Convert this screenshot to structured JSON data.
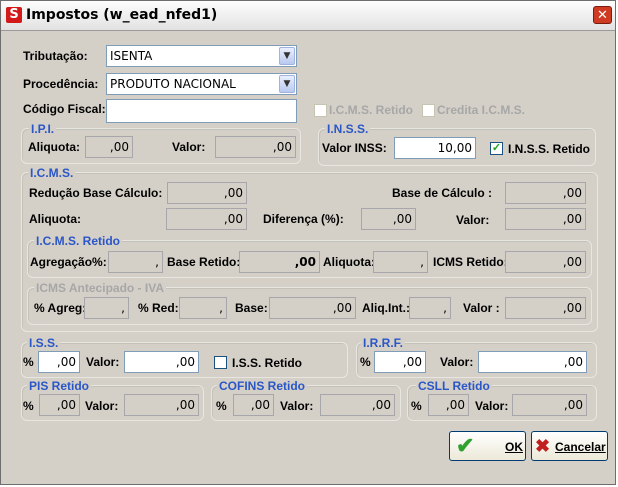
{
  "window": {
    "title": "Impostos (w_ead_nfed1)",
    "app_icon": "S",
    "close_glyph": "✕"
  },
  "tributacao": {
    "label": "Tributação:",
    "value": "ISENTA"
  },
  "procedencia": {
    "label": "Procedência:",
    "value": "PRODUTO NACIONAL"
  },
  "codigo_fiscal": {
    "label": "Código Fiscal:",
    "value": ""
  },
  "icms_retido_chk": {
    "label": "I.C.M.S. Retido",
    "checked": false,
    "enabled": false
  },
  "credita_icms_chk": {
    "label": "Credita I.C.M.S.",
    "checked": false,
    "enabled": false
  },
  "ipi": {
    "title": "I.P.I.",
    "aliquota_label": "Aliquota:",
    "aliquota": ",00",
    "valor_label": "Valor:",
    "valor": ",00"
  },
  "inss": {
    "title": "I.N.S.S.",
    "valor_label": "Valor INSS:",
    "valor": "10,00",
    "retido_label": "I.N.S.S. Retido",
    "retido_checked": true
  },
  "icms": {
    "title": "I.C.M.S.",
    "reducao_label": "Redução Base Cálculo:",
    "reducao": ",00",
    "base_calc_label": "Base de Cálculo :",
    "base_calc": ",00",
    "aliquota_label": "Aliquota:",
    "aliquota": ",00",
    "diferenca_label": "Diferença (%):",
    "diferenca": ",00",
    "valor_label": "Valor:",
    "valor": ",00"
  },
  "icms_retido": {
    "title": "I.C.M.S. Retido",
    "agregacao_label": "Agregação%:",
    "agregacao": ",",
    "base_label": "Base Retido:",
    "base": ",00",
    "aliquota_label": "Aliquota:",
    "aliquota": ",",
    "icms_label": "ICMS Retido:",
    "icms": ",00"
  },
  "icms_antecipado": {
    "title": "ICMS Antecipado - IVA",
    "agreg_label": "% Agreg:",
    "agreg": ",",
    "red_label": "% Red:",
    "red": ",",
    "base_label": "Base:",
    "base": ",00",
    "aliq_label": "Aliq.Int.:",
    "aliq": ",",
    "valor_label": "Valor :",
    "valor": ",00"
  },
  "iss": {
    "title": "I.S.S.",
    "pct_label": "%",
    "pct": ",00",
    "valor_label": "Valor:",
    "valor": ",00",
    "retido_label": "I.S.S. Retido",
    "retido_checked": false
  },
  "irrf": {
    "title": "I.R.R.F.",
    "pct_label": "%",
    "pct": ",00",
    "valor_label": "Valor:",
    "valor": ",00"
  },
  "pis": {
    "title": "PIS Retido",
    "pct_label": "%",
    "pct": ",00",
    "valor_label": "Valor:",
    "valor": ",00"
  },
  "cofins": {
    "title": "COFINS Retido",
    "pct_label": "%",
    "pct": ",00",
    "valor_label": "Valor:",
    "valor": ",00"
  },
  "csll": {
    "title": "CSLL Retido",
    "pct_label": "%",
    "pct": ",00",
    "valor_label": "Valor:",
    "valor": ",00"
  },
  "buttons": {
    "ok_label": "OK",
    "cancel_label": "Cancelar",
    "ok_icon": "✔",
    "cancel_icon": "✖"
  },
  "colors": {
    "section_title": "#2a56c8",
    "ok_check": "#2fa12f",
    "cancel_x": "#c21f1f",
    "window_bg": "#d4d0c8"
  }
}
